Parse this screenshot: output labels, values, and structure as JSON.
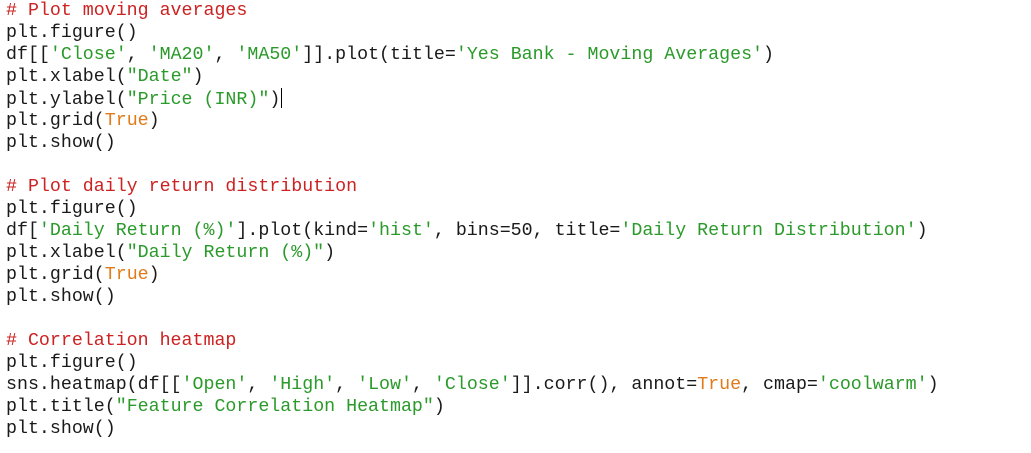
{
  "editor": {
    "colors": {
      "background": "#ffffff",
      "comment": "#cc2222",
      "string": "#2a9a2a",
      "constant": "#e07a1a",
      "plain": "#1a1a1a"
    },
    "caret": {
      "line": 4
    },
    "lines": [
      [
        {
          "t": "comment",
          "v": "# Plot moving averages"
        }
      ],
      [
        {
          "t": "plain",
          "v": "plt.figure()"
        }
      ],
      [
        {
          "t": "plain",
          "v": "df[["
        },
        {
          "t": "string",
          "v": "'Close'"
        },
        {
          "t": "plain",
          "v": ", "
        },
        {
          "t": "string",
          "v": "'MA20'"
        },
        {
          "t": "plain",
          "v": ", "
        },
        {
          "t": "string",
          "v": "'MA50'"
        },
        {
          "t": "plain",
          "v": "]].plot(title="
        },
        {
          "t": "string",
          "v": "'Yes Bank - Moving Averages'"
        },
        {
          "t": "plain",
          "v": ")"
        }
      ],
      [
        {
          "t": "plain",
          "v": "plt.xlabel("
        },
        {
          "t": "string",
          "v": "\"Date\""
        },
        {
          "t": "plain",
          "v": ")"
        }
      ],
      [
        {
          "t": "plain",
          "v": "plt.ylabel("
        },
        {
          "t": "string",
          "v": "\"Price (INR)\""
        },
        {
          "t": "plain",
          "v": ")"
        }
      ],
      [
        {
          "t": "plain",
          "v": "plt.grid("
        },
        {
          "t": "const",
          "v": "True"
        },
        {
          "t": "plain",
          "v": ")"
        }
      ],
      [
        {
          "t": "plain",
          "v": "plt.show()"
        }
      ],
      [],
      [
        {
          "t": "comment",
          "v": "# Plot daily return distribution"
        }
      ],
      [
        {
          "t": "plain",
          "v": "plt.figure()"
        }
      ],
      [
        {
          "t": "plain",
          "v": "df["
        },
        {
          "t": "string",
          "v": "'Daily Return (%)'"
        },
        {
          "t": "plain",
          "v": "].plot(kind="
        },
        {
          "t": "string",
          "v": "'hist'"
        },
        {
          "t": "plain",
          "v": ", bins=50, title="
        },
        {
          "t": "string",
          "v": "'Daily Return Distribution'"
        },
        {
          "t": "plain",
          "v": ")"
        }
      ],
      [
        {
          "t": "plain",
          "v": "plt.xlabel("
        },
        {
          "t": "string",
          "v": "\"Daily Return (%)\""
        },
        {
          "t": "plain",
          "v": ")"
        }
      ],
      [
        {
          "t": "plain",
          "v": "plt.grid("
        },
        {
          "t": "const",
          "v": "True"
        },
        {
          "t": "plain",
          "v": ")"
        }
      ],
      [
        {
          "t": "plain",
          "v": "plt.show()"
        }
      ],
      [],
      [
        {
          "t": "comment",
          "v": "# Correlation heatmap"
        }
      ],
      [
        {
          "t": "plain",
          "v": "plt.figure()"
        }
      ],
      [
        {
          "t": "plain",
          "v": "sns.heatmap(df[["
        },
        {
          "t": "string",
          "v": "'Open'"
        },
        {
          "t": "plain",
          "v": ", "
        },
        {
          "t": "string",
          "v": "'High'"
        },
        {
          "t": "plain",
          "v": ", "
        },
        {
          "t": "string",
          "v": "'Low'"
        },
        {
          "t": "plain",
          "v": ", "
        },
        {
          "t": "string",
          "v": "'Close'"
        },
        {
          "t": "plain",
          "v": "]].corr(), annot="
        },
        {
          "t": "const",
          "v": "True"
        },
        {
          "t": "plain",
          "v": ", cmap="
        },
        {
          "t": "string",
          "v": "'coolwarm'"
        },
        {
          "t": "plain",
          "v": ")"
        }
      ],
      [
        {
          "t": "plain",
          "v": "plt.title("
        },
        {
          "t": "string",
          "v": "\"Feature Correlation Heatmap\""
        },
        {
          "t": "plain",
          "v": ")"
        }
      ],
      [
        {
          "t": "plain",
          "v": "plt.show()"
        }
      ]
    ]
  }
}
